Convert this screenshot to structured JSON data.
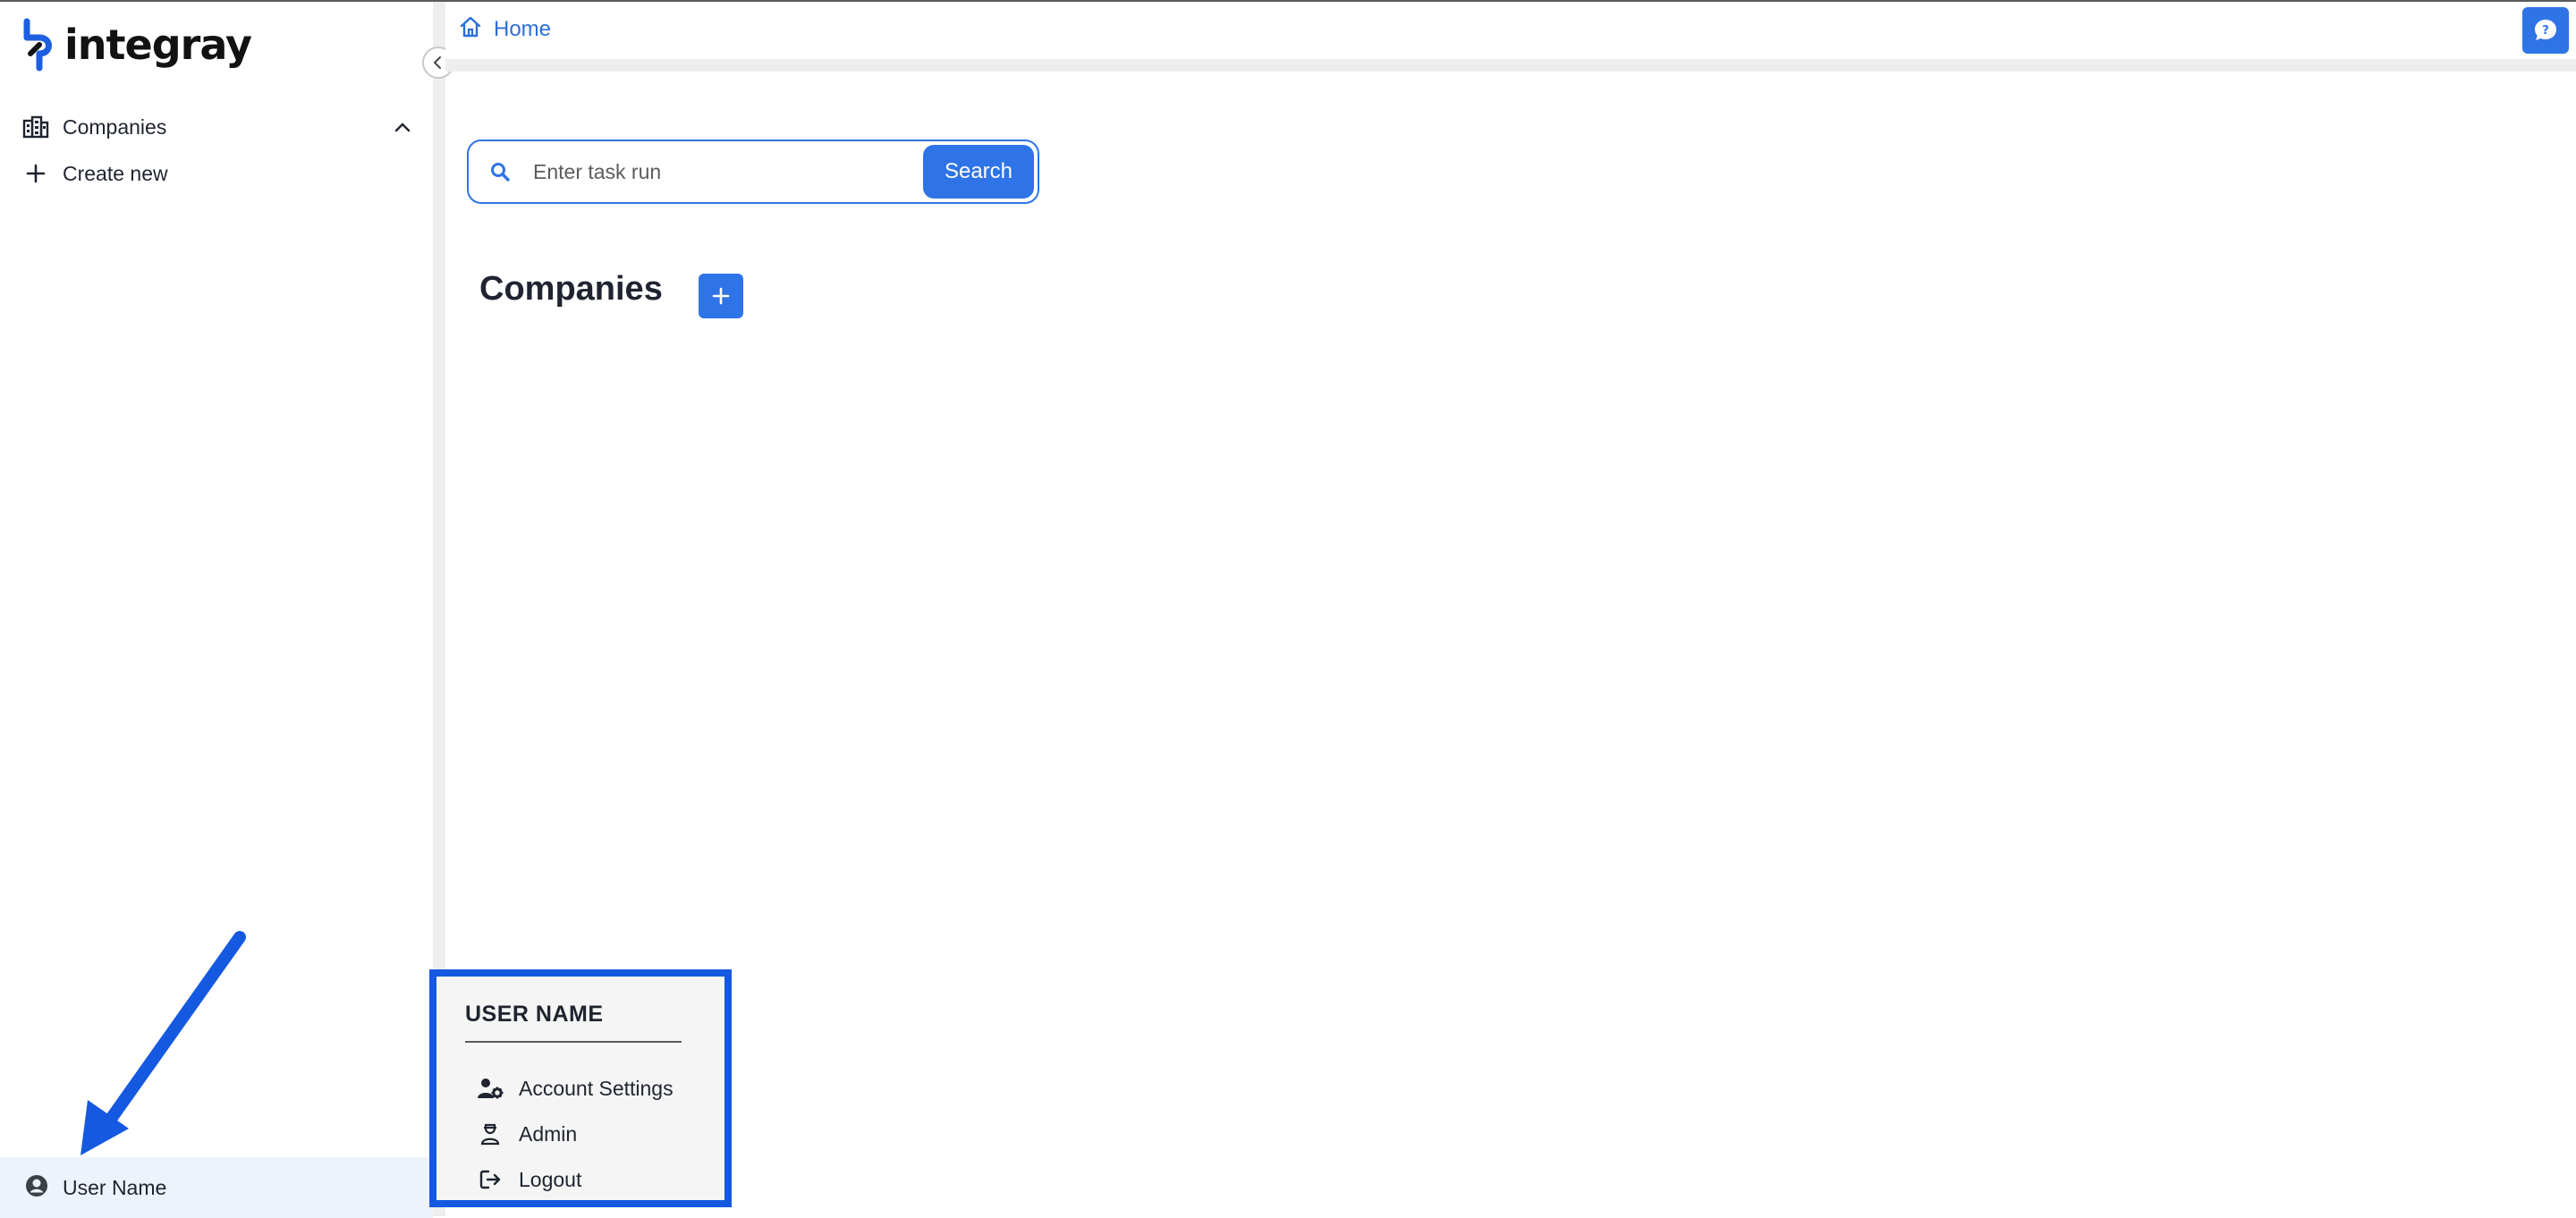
{
  "app": {
    "logo_text": "integray"
  },
  "sidebar": {
    "group_label": "Companies",
    "items": [
      {
        "label": "Create new"
      }
    ],
    "user_label": "User Name"
  },
  "header": {
    "breadcrumb": "Home"
  },
  "search": {
    "placeholder": "Enter task run",
    "button_label": "Search"
  },
  "main": {
    "section_title": "Companies"
  },
  "user_menu": {
    "title": "USER NAME",
    "items": [
      {
        "label": "Account Settings",
        "icon": "user-gear-icon"
      },
      {
        "label": "Admin",
        "icon": "admin-icon"
      },
      {
        "label": "Logout",
        "icon": "logout-icon"
      }
    ]
  },
  "colors": {
    "accent": "#2f74e6",
    "highlight_border": "#1559e0",
    "link": "#2c6ed8"
  }
}
